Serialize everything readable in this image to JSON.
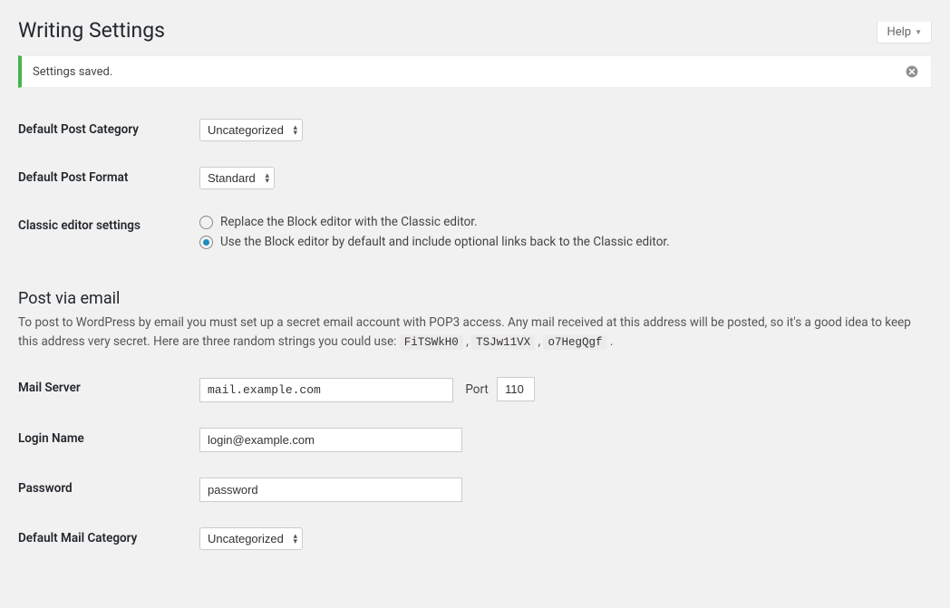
{
  "help_label": "Help",
  "page_title": "Writing Settings",
  "notice": {
    "message": "Settings saved."
  },
  "fields": {
    "default_post_category": {
      "label": "Default Post Category",
      "value": "Uncategorized"
    },
    "default_post_format": {
      "label": "Default Post Format",
      "value": "Standard"
    },
    "classic_editor": {
      "label": "Classic editor settings",
      "options": [
        "Replace the Block editor with the Classic editor.",
        "Use the Block editor by default and include optional links back to the Classic editor."
      ],
      "selected_index": 1
    }
  },
  "post_via_email": {
    "heading": "Post via email",
    "description_pre": "To post to WordPress by email you must set up a secret email account with POP3 access. Any mail received at this address will be posted, so it's a good idea to keep this address very secret. Here are three random strings you could use: ",
    "random_strings": [
      "FiTSWkH0",
      "TSJw11VX",
      "o7HegQgf"
    ],
    "mail_server": {
      "label": "Mail Server",
      "value": "mail.example.com",
      "port_label": "Port",
      "port_value": "110"
    },
    "login_name": {
      "label": "Login Name",
      "value": "login@example.com"
    },
    "password": {
      "label": "Password",
      "value": "password"
    },
    "default_mail_category": {
      "label": "Default Mail Category",
      "value": "Uncategorized"
    }
  }
}
